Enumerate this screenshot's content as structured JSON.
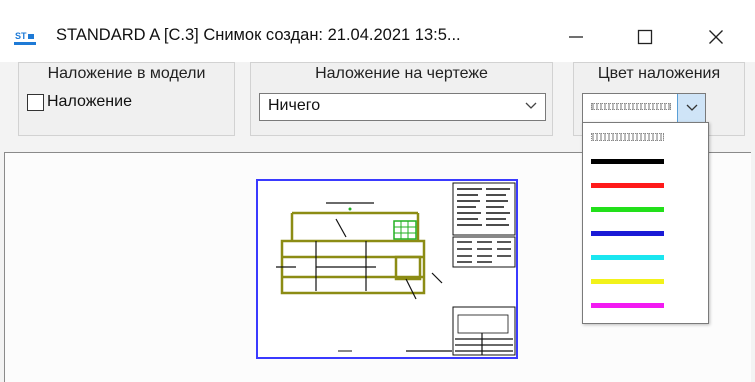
{
  "window": {
    "title": "STANDARD A   [C.3]   Снимок создан: 21.04.2021 13:5..."
  },
  "panels": {
    "model_overlay": {
      "label": "Наложение в модели",
      "checkbox_label": "Наложение",
      "checked": false
    },
    "drawing_overlay": {
      "label": "Наложение на чертеже",
      "selected": "Ничего"
    },
    "overlay_color": {
      "label": "Цвет наложения",
      "selected": "dotted",
      "options": [
        {
          "name": "dotted",
          "color": "#bbbbbb"
        },
        {
          "name": "black",
          "color": "#000000"
        },
        {
          "name": "red",
          "color": "#ff1a1a"
        },
        {
          "name": "green",
          "color": "#22e01a"
        },
        {
          "name": "blue",
          "color": "#1a1ad6"
        },
        {
          "name": "cyan",
          "color": "#1ae6f0"
        },
        {
          "name": "yellow",
          "color": "#f2f21a"
        },
        {
          "name": "magenta",
          "color": "#f21af2"
        }
      ]
    }
  },
  "colors": {
    "accent": "#0078d7",
    "drawing_frame": "#3a3aff",
    "highlight_shape": "#8c8c14",
    "highlight_grid": "#22b022"
  }
}
